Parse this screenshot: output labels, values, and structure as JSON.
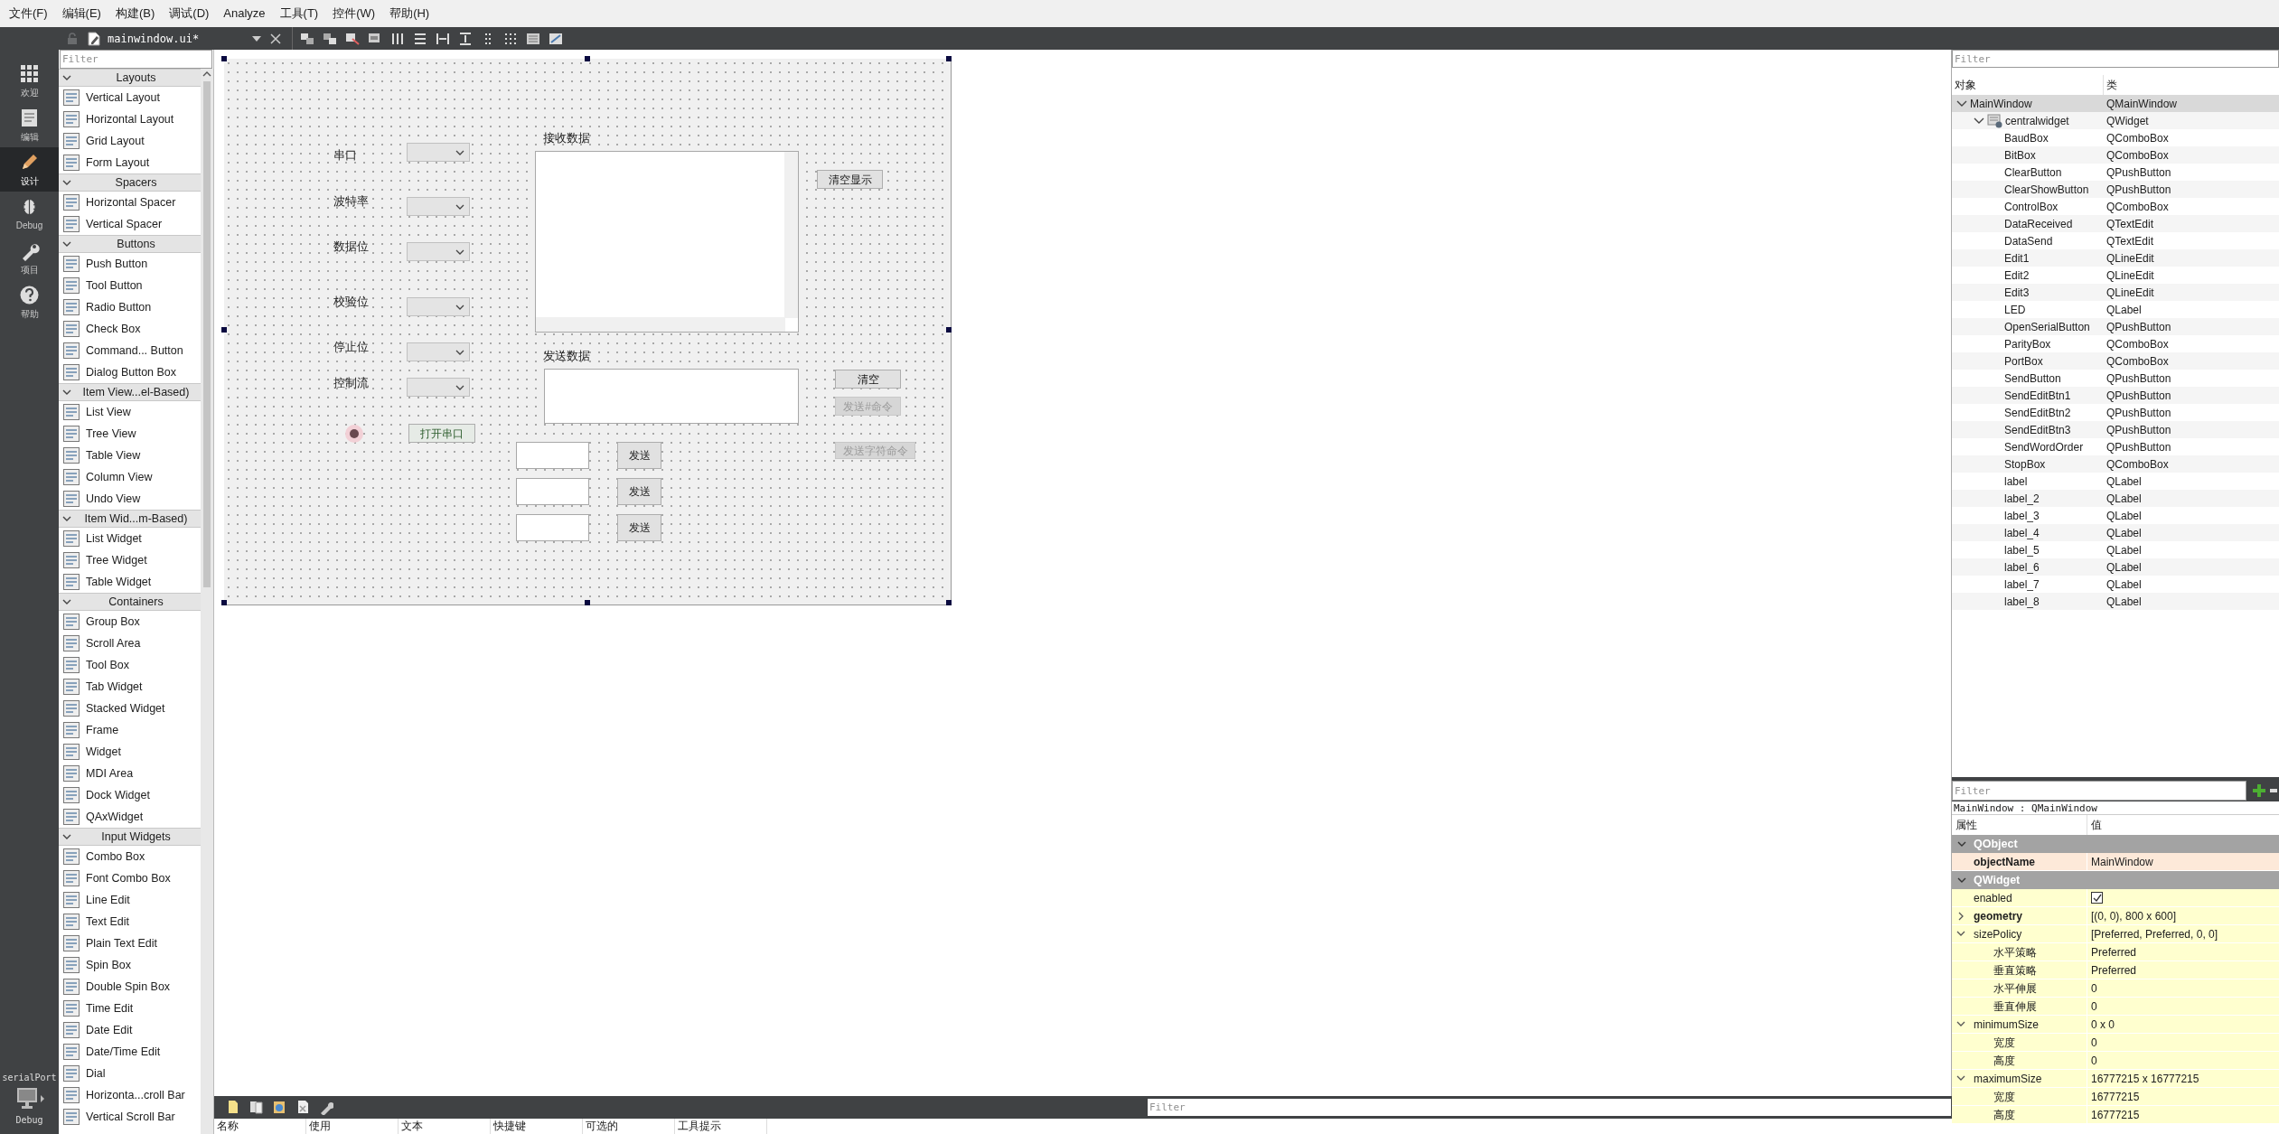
{
  "menu_bar": [
    "文件(F)",
    "编辑(E)",
    "构建(B)",
    "调试(D)",
    "Analyze",
    "工具(T)",
    "控件(W)",
    "帮助(H)"
  ],
  "editor_toolbar": {
    "file": "mainwindow.ui*"
  },
  "mode_bar": {
    "items": [
      {
        "label": "欢迎",
        "kind": "grid",
        "selected": false
      },
      {
        "label": "编辑",
        "kind": "document",
        "selected": false
      },
      {
        "label": "设计",
        "kind": "pencil",
        "selected": true
      },
      {
        "label": "Debug",
        "kind": "bug",
        "selected": false
      },
      {
        "label": "项目",
        "kind": "wrench",
        "selected": false
      },
      {
        "label": "帮助",
        "kind": "help",
        "selected": false
      }
    ],
    "project": "serialPort",
    "build": "Debug"
  },
  "widget_box": {
    "placeholder": "Filter",
    "sections": [
      {
        "title": "Layouts",
        "items": [
          "Vertical Layout",
          "Horizontal Layout",
          "Grid Layout",
          "Form Layout"
        ]
      },
      {
        "title": "Spacers",
        "items": [
          "Horizontal Spacer",
          "Vertical Spacer"
        ]
      },
      {
        "title": "Buttons",
        "items": [
          "Push Button",
          "Tool Button",
          "Radio Button",
          "Check Box",
          "Command... Button",
          "Dialog Button Box"
        ]
      },
      {
        "title": "Item View...el-Based)",
        "items": [
          "List View",
          "Tree View",
          "Table View",
          "Column View",
          "Undo View"
        ]
      },
      {
        "title": "Item Wid...m-Based)",
        "items": [
          "List Widget",
          "Tree Widget",
          "Table Widget"
        ]
      },
      {
        "title": "Containers",
        "items": [
          "Group Box",
          "Scroll Area",
          "Tool Box",
          "Tab Widget",
          "Stacked Widget",
          "Frame",
          "Widget",
          "MDI Area",
          "Dock Widget",
          "QAxWidget"
        ]
      },
      {
        "title": "Input Widgets",
        "items": [
          "Combo Box",
          "Font Combo Box",
          "Line Edit",
          "Text Edit",
          "Plain Text Edit",
          "Spin Box",
          "Double Spin Box",
          "Time Edit",
          "Date Edit",
          "Date/Time Edit",
          "Dial",
          "Horizonta...croll Bar",
          "Vertical Scroll Bar"
        ]
      }
    ]
  },
  "form": {
    "port_settings": [
      "串口",
      "波特率",
      "数据位",
      "校验位",
      "停止位",
      "控制流"
    ],
    "open_button": "打开串口",
    "receive_label": "接收数据",
    "clear_display_button": "清空显示",
    "send_label": "发送数据",
    "side_buttons": [
      {
        "text": "清空",
        "disabled": false
      },
      {
        "text": "发送#命令",
        "disabled": true
      },
      {
        "text": "发送字符命令",
        "disabled": true
      }
    ],
    "quick_sends": [
      "发送",
      "发送",
      "发送"
    ]
  },
  "object_inspector": {
    "placeholder": "Filter",
    "columns": [
      "对象",
      "类"
    ],
    "tree": [
      {
        "name": "MainWindow",
        "class": "QMainWindow",
        "selected": true,
        "expanded": true,
        "children": [
          {
            "name": "centralwidget",
            "class": "QWidget",
            "selected": false,
            "expanded": true,
            "children": [
              {
                "name": "BaudBox",
                "class": "QComboBox",
                "selected": false
              },
              {
                "name": "BitBox",
                "class": "QComboBox",
                "selected": false
              },
              {
                "name": "ClearButton",
                "class": "QPushButton",
                "selected": false
              },
              {
                "name": "ClearShowButton",
                "class": "QPushButton",
                "selected": false
              },
              {
                "name": "ControlBox",
                "class": "QComboBox",
                "selected": false
              },
              {
                "name": "DataReceived",
                "class": "QTextEdit",
                "selected": false
              },
              {
                "name": "DataSend",
                "class": "QTextEdit",
                "selected": false
              },
              {
                "name": "Edit1",
                "class": "QLineEdit",
                "selected": false
              },
              {
                "name": "Edit2",
                "class": "QLineEdit",
                "selected": false
              },
              {
                "name": "Edit3",
                "class": "QLineEdit",
                "selected": false
              },
              {
                "name": "LED",
                "class": "QLabel",
                "selected": false
              },
              {
                "name": "OpenSerialButton",
                "class": "QPushButton",
                "selected": false
              },
              {
                "name": "ParityBox",
                "class": "QComboBox",
                "selected": false
              },
              {
                "name": "PortBox",
                "class": "QComboBox",
                "selected": false
              },
              {
                "name": "SendButton",
                "class": "QPushButton",
                "selected": false
              },
              {
                "name": "SendEditBtn1",
                "class": "QPushButton",
                "selected": false
              },
              {
                "name": "SendEditBtn2",
                "class": "QPushButton",
                "selected": false
              },
              {
                "name": "SendEditBtn3",
                "class": "QPushButton",
                "selected": false
              },
              {
                "name": "SendWordOrder",
                "class": "QPushButton",
                "selected": false
              },
              {
                "name": "StopBox",
                "class": "QComboBox",
                "selected": false
              },
              {
                "name": "label",
                "class": "QLabel",
                "selected": false
              },
              {
                "name": "label_2",
                "class": "QLabel",
                "selected": false
              },
              {
                "name": "label_3",
                "class": "QLabel",
                "selected": false
              },
              {
                "name": "label_4",
                "class": "QLabel",
                "selected": false
              },
              {
                "name": "label_5",
                "class": "QLabel",
                "selected": false
              },
              {
                "name": "label_6",
                "class": "QLabel",
                "selected": false
              },
              {
                "name": "label_7",
                "class": "QLabel",
                "selected": false
              },
              {
                "name": "label_8",
                "class": "QLabel",
                "selected": false
              }
            ]
          }
        ]
      }
    ]
  },
  "property_editor": {
    "placeholder": "Filter",
    "object": "MainWindow : QMainWindow",
    "columns": [
      "属性",
      "值"
    ],
    "groups": [
      {
        "title": "QObject",
        "color": "#fde9d9",
        "properties": [
          {
            "name": "objectName",
            "value": "MainWindow",
            "modified": true
          }
        ]
      },
      {
        "title": "QWidget",
        "color": "#ffffcf",
        "properties": [
          {
            "name": "enabled",
            "kind": "checkbox",
            "checked": true,
            "modified": false
          },
          {
            "name": "geometry",
            "value": "[(0, 0), 800 x 600]",
            "modified": true,
            "expanded": false
          },
          {
            "name": "sizePolicy",
            "value": "[Preferred, Preferred, 0, 0]",
            "modified": false,
            "expanded": true,
            "children": [
              {
                "name": "水平策略",
                "value": "Preferred"
              },
              {
                "name": "垂直策略",
                "value": "Preferred"
              },
              {
                "name": "水平伸展",
                "value": "0"
              },
              {
                "name": "垂直伸展",
                "value": "0"
              }
            ]
          },
          {
            "name": "minimumSize",
            "value": "0 x 0",
            "modified": false,
            "expanded": true,
            "children": [
              {
                "name": "宽度",
                "value": "0"
              },
              {
                "name": "高度",
                "value": "0"
              }
            ]
          },
          {
            "name": "maximumSize",
            "value": "16777215 x 16777215",
            "modified": false,
            "expanded": true,
            "children": [
              {
                "name": "宽度",
                "value": "16777215"
              },
              {
                "name": "高度",
                "value": "16777215"
              }
            ]
          }
        ]
      }
    ]
  },
  "action_editor": {
    "placeholder": "Filter",
    "columns": [
      "名称",
      "使用",
      "文本",
      "快捷键",
      "可选的",
      "工具提示"
    ]
  }
}
